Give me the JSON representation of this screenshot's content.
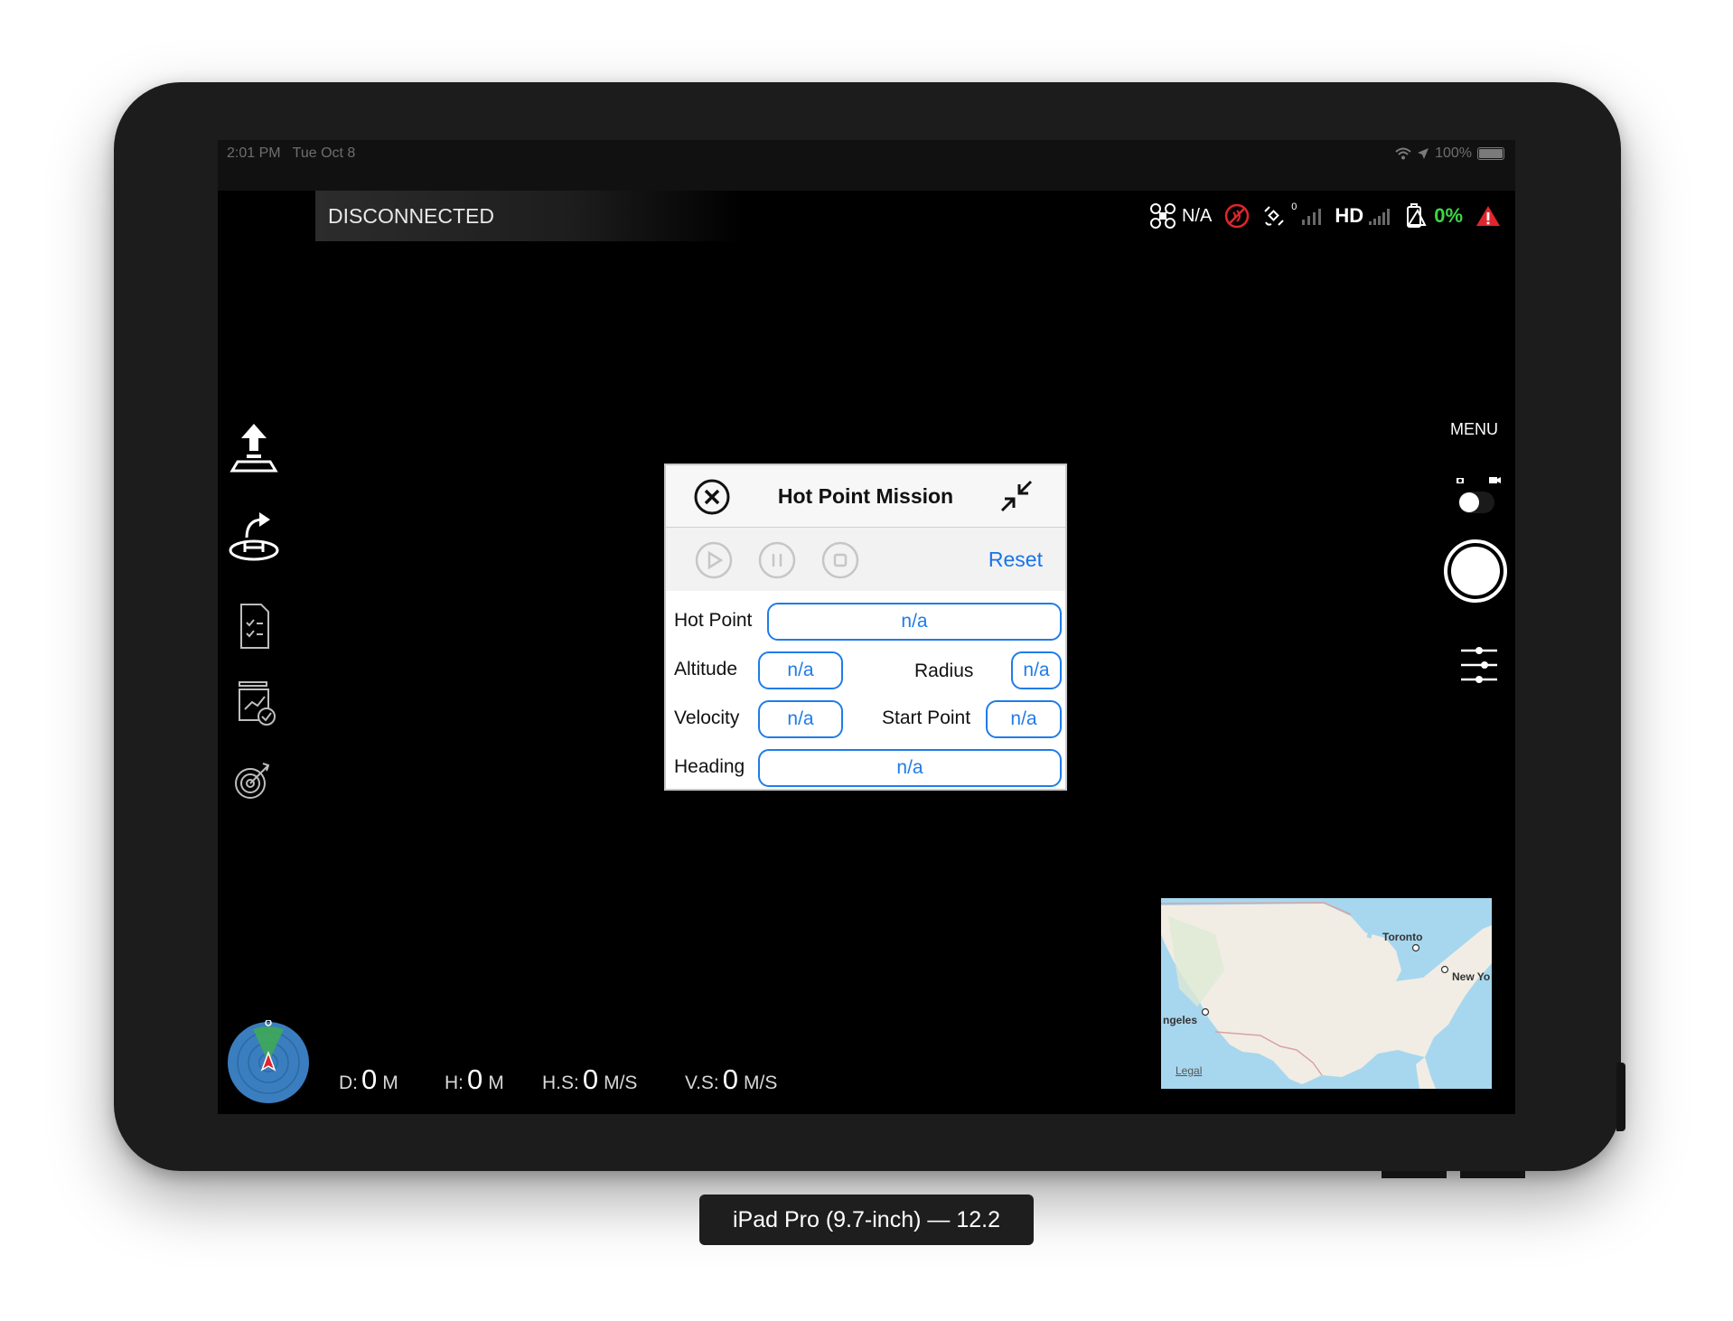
{
  "status_bar": {
    "time": "2:01 PM",
    "date": "Tue Oct 8",
    "battery": "100%"
  },
  "top_bar": {
    "connection": "DISCONNECTED",
    "aircraft_status": "N/A",
    "gps_count": "0",
    "hd_label": "HD",
    "battery_percent": "0%"
  },
  "right_panel": {
    "menu": "MENU"
  },
  "mission_panel": {
    "title": "Hot Point Mission",
    "reset": "Reset",
    "fields": {
      "hot_point": {
        "label": "Hot Point",
        "value": "n/a"
      },
      "altitude": {
        "label": "Altitude",
        "value": "n/a"
      },
      "radius": {
        "label": "Radius",
        "value": "n/a"
      },
      "velocity": {
        "label": "Velocity",
        "value": "n/a"
      },
      "start_point": {
        "label": "Start Point",
        "value": "n/a"
      },
      "heading": {
        "label": "Heading",
        "value": "n/a"
      }
    }
  },
  "map": {
    "labels": [
      "Toronto",
      "New Yo",
      "ngeles"
    ],
    "legal": "Legal"
  },
  "telemetry": {
    "distance": {
      "label": "D:",
      "value": "0",
      "unit": "M"
    },
    "height": {
      "label": "H:",
      "value": "0",
      "unit": "M"
    },
    "h_speed": {
      "label": "H.S:",
      "value": "0",
      "unit": "M/S"
    },
    "v_speed": {
      "label": "V.S:",
      "value": "0",
      "unit": "M/S"
    }
  },
  "device_caption": "iPad Pro (9.7-inch) — 12.2",
  "colors": {
    "accent_blue": "#1f7ce8",
    "battery_green": "#3fd447",
    "warning_red": "#e0262d"
  }
}
